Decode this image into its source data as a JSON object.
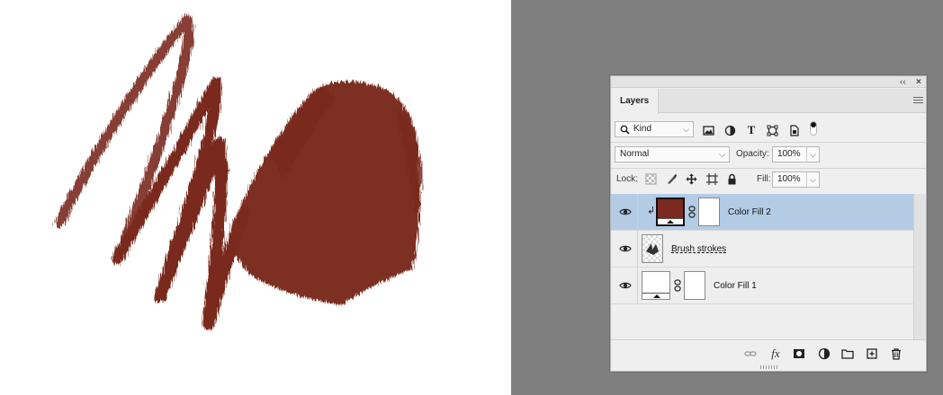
{
  "panel": {
    "collapse_glyph": "‹‹",
    "close_glyph": "×",
    "tab_label": "Layers",
    "menu_icon": "hamburger-menu-icon"
  },
  "filter": {
    "kind_label": "Kind",
    "kind_icon": "search-icon",
    "icons": [
      "image-filter-icon",
      "adjustment-filter-icon",
      "type-filter-icon",
      "shape-filter-icon",
      "smart-object-filter-icon"
    ],
    "type_glyph": "T"
  },
  "blend": {
    "mode": "Normal",
    "opacity_label": "Opacity:",
    "opacity_value": "100%"
  },
  "lock": {
    "label": "Lock:",
    "fill_label": "Fill:",
    "fill_value": "100%"
  },
  "layers": [
    {
      "name": "Color Fill 2",
      "selected": true,
      "clipped": true,
      "thumb_color": "#7a2a1e",
      "has_mask": true
    },
    {
      "name": "Brush strokes",
      "selected": false,
      "clipped": false,
      "transparent": true,
      "has_mask": false
    },
    {
      "name": "Color Fill 1",
      "selected": false,
      "clipped": false,
      "thumb_color": "#ffffff",
      "has_mask": true
    }
  ],
  "bottom_fx": "fx",
  "colors": {
    "brush": "#7a2a1e",
    "selection": "#b4cbe6",
    "workspace": "#808080"
  }
}
